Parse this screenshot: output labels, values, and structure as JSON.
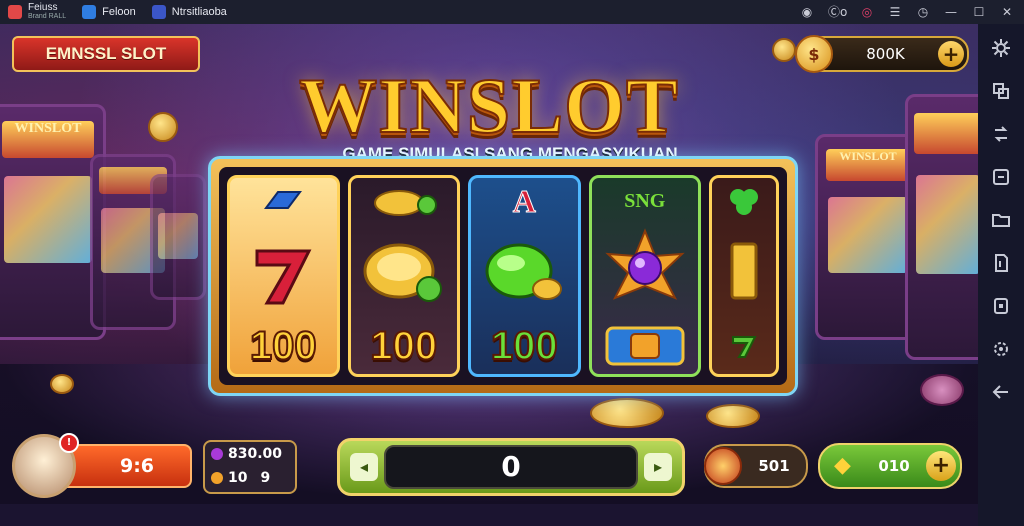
{
  "titlebar": {
    "tab1": "Feiuss",
    "tab1_sub": "Brand RALL",
    "tab2": "Feloon",
    "tab3": "Ntrsitliaoba",
    "controls": [
      "◉",
      "Ⓒo",
      "◎",
      "☰",
      "◷",
      "—",
      "☐",
      "✕"
    ]
  },
  "game": {
    "badge": "EMNSSL SLOT",
    "top_balance": "800K",
    "title": "WINSLOT",
    "subtitle": "GAME SIMULASI SANG MENGASYIKUAN",
    "machine_label": "WINSLOT",
    "reels": [
      {
        "top_symbol": "diamond-ring",
        "mid_symbol": "seven",
        "value": "100",
        "value_color": "#ffd23a"
      },
      {
        "top_symbol": "coin",
        "mid_symbol": "gold-coin",
        "value": "100",
        "value_color": "#ffd23a"
      },
      {
        "top_symbol": "A",
        "mid_symbol": "green-gem",
        "value": "100",
        "value_color": "#6ae03a"
      },
      {
        "top_symbol": "SNG",
        "mid_symbol": "purple-sun-gem",
        "value": "",
        "value_color": "#ffd23a"
      },
      {
        "top_symbol": "clover",
        "mid_symbol": "bar",
        "value": "",
        "value_color": "#ffd23a"
      }
    ],
    "hp": "9:6",
    "avatar_alert": "!",
    "gems_top": "830.00",
    "gems_bottom_a": "10",
    "gems_bottom_b": "9",
    "spin_display": "0",
    "stat_value": "501",
    "buy_value": "010",
    "colors": {
      "gold": "#ffcc2e",
      "accent_green": "#7ac83a",
      "accent_red": "#d9342a"
    }
  }
}
